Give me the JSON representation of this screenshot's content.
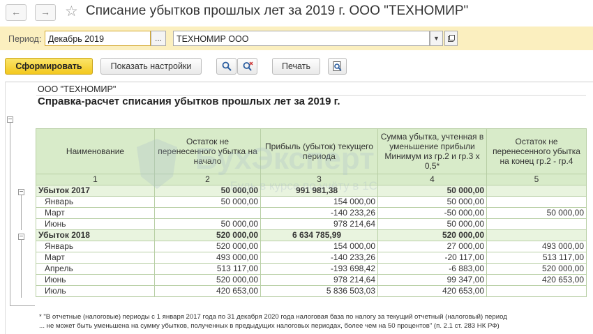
{
  "window": {
    "title": "Списание убытков прошлых лет за 2019 г. ООО \"ТЕХНОМИР\"",
    "back_icon": "arrow-left-icon",
    "forward_icon": "arrow-right-icon",
    "favorite_icon": "star-icon"
  },
  "params": {
    "period_label": "Период:",
    "period_value": "Декабрь 2019",
    "period_select_label": "...",
    "organization_value": "ТЕХНОМИР ООО"
  },
  "toolbar": {
    "generate_label": "Сформировать",
    "settings_label": "Показать настройки",
    "print_label": "Печать"
  },
  "report": {
    "company": "ООО \"ТЕХНОМИР\"",
    "title": "Справка-расчет списания убытков прошлых лет за 2019 г.",
    "headers": [
      "Наименование",
      "Остаток не перенесенного убытка на начало",
      "Прибыль (убыток) текущего периода",
      "Сумма убытка, учтенная в уменьшение прибыли Минимум из гр.2 и гр.3 x 0,5*",
      "Остаток не перенесенного убытка на конец гр.2 - гр.4"
    ],
    "col_numbers": [
      "1",
      "2",
      "3",
      "4",
      "5"
    ],
    "groups": [
      {
        "name": "Убыток 2017",
        "values": [
          "50 000,00",
          "991 981,38",
          "50 000,00",
          ""
        ],
        "rows": [
          {
            "name": "Январь",
            "values": [
              "50 000,00",
              "154 000,00",
              "50 000,00",
              ""
            ]
          },
          {
            "name": "Март",
            "values": [
              "",
              "-140 233,26",
              "-50 000,00",
              "50 000,00"
            ]
          },
          {
            "name": "Июнь",
            "values": [
              "50 000,00",
              "978 214,64",
              "50 000,00",
              ""
            ]
          }
        ]
      },
      {
        "name": "Убыток 2018",
        "values": [
          "520 000,00",
          "6 634 785,99",
          "520 000,00",
          ""
        ],
        "rows": [
          {
            "name": "Январь",
            "values": [
              "520 000,00",
              "154 000,00",
              "27 000,00",
              "493 000,00"
            ]
          },
          {
            "name": "Март",
            "values": [
              "493 000,00",
              "-140 233,26",
              "-20 117,00",
              "513 117,00"
            ]
          },
          {
            "name": "Апрель",
            "values": [
              "513 117,00",
              "-193 698,42",
              "-6 883,00",
              "520 000,00"
            ]
          },
          {
            "name": "Июнь",
            "values": [
              "520 000,00",
              "978 214,64",
              "99 347,00",
              "420 653,00"
            ]
          },
          {
            "name": "Июль",
            "values": [
              "420 653,00",
              "5 836 503,03",
              "420 653,00",
              ""
            ]
          }
        ]
      }
    ],
    "footnote_line1": "* \"В отчетные (налоговые) периоды с 1 января 2017 года по 31 декабря 2020 года налоговая база по налогу за текущий отчетный (налоговый) период",
    "footnote_line2": "... не может быть уменьшена на сумму убытков, полученных в предыдущих налоговых периодах, более чем на 50 процентов\" (п. 2.1 ст. 283 НК РФ)"
  },
  "watermark": {
    "brand": "БухЭксперт",
    "tagline": "Будь в курсе по учёту в 1С"
  }
}
